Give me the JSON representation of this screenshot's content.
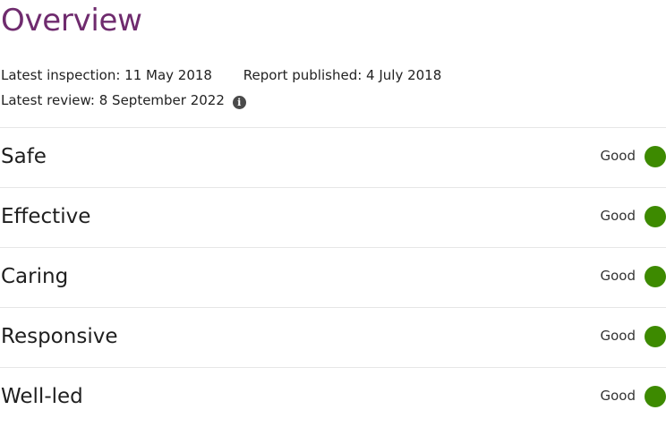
{
  "page": {
    "title": "Overview"
  },
  "inspection": {
    "latest_inspection": "Latest inspection: 11 May 2018",
    "report_published": "Report published: 4 July 2018",
    "latest_review": "Latest review: 8 September 2022",
    "info_icon": "info-icon"
  },
  "ratings": [
    {
      "label": "Safe",
      "value": "Good",
      "color": "#3d8a00"
    },
    {
      "label": "Effective",
      "value": "Good",
      "color": "#3d8a00"
    },
    {
      "label": "Caring",
      "value": "Good",
      "color": "#3d8a00"
    },
    {
      "label": "Responsive",
      "value": "Good",
      "color": "#3d8a00"
    },
    {
      "label": "Well-led",
      "value": "Good",
      "color": "#3d8a00"
    }
  ],
  "colors": {
    "title": "#6f2b6e",
    "good": "#3d8a00"
  }
}
